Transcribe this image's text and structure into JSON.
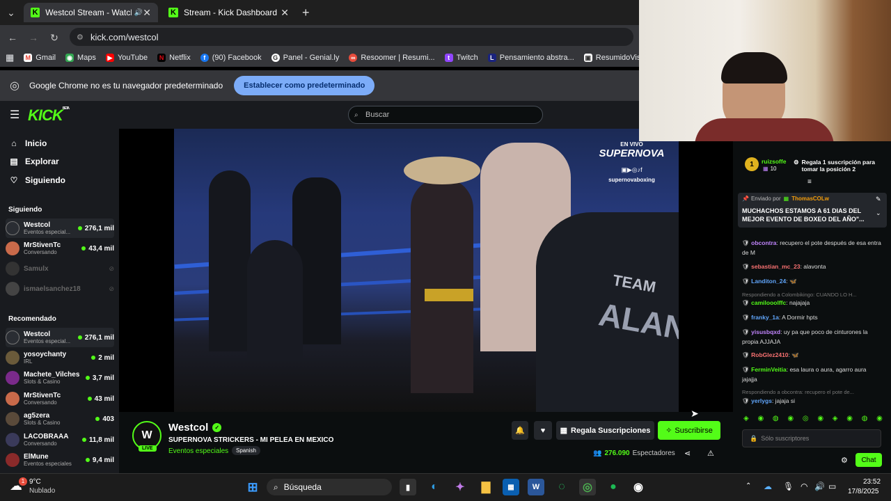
{
  "browser": {
    "tabs": [
      {
        "label": "Westcol Stream - Watch Live",
        "active": true
      },
      {
        "label": "Stream - Kick Dashboard",
        "active": false
      }
    ],
    "url": "kick.com/westcol",
    "bookmarks": [
      "Gmail",
      "Maps",
      "YouTube",
      "Netflix",
      "(90) Facebook",
      "Panel - Genial.ly",
      "Resoomer | Resumi...",
      "Twitch",
      "Pensamiento abstra...",
      "ResumidoVisualBasi..."
    ],
    "infobar": {
      "text": "Google Chrome no es tu navegador predeterminado",
      "button": "Establecer como predeterminado"
    }
  },
  "kick": {
    "logo": "KICK",
    "beta": "BETA",
    "search_placeholder": "Buscar",
    "nav": [
      "Inicio",
      "Explorar",
      "Siguiendo"
    ],
    "following_title": "Siguiendo",
    "following": [
      {
        "name": "Westcol",
        "sub": "Eventos especial...",
        "viewers": "276,1 mil",
        "color": "#2a2d33"
      },
      {
        "name": "MrStivenTc",
        "sub": "Conversando",
        "viewers": "43,4 mil",
        "color": "#c96a4a"
      },
      {
        "name": "Samulx",
        "sub": "",
        "viewers": "",
        "color": "#333"
      },
      {
        "name": "ismaelsanchez18",
        "sub": "",
        "viewers": "",
        "color": "#444"
      }
    ],
    "recommended_title": "Recomendado",
    "recommended": [
      {
        "name": "Westcol",
        "sub": "Eventos especial...",
        "viewers": "276,1 mil",
        "color": "#2a2d33"
      },
      {
        "name": "yosoychanty",
        "sub": "IRL",
        "viewers": "2 mil",
        "color": "#6a5a3a"
      },
      {
        "name": "Machete_Vilches",
        "sub": "Slots & Casino",
        "viewers": "3,7 mil",
        "color": "#7a2a8a"
      },
      {
        "name": "MrStivenTc",
        "sub": "Conversando",
        "viewers": "43 mil",
        "color": "#c96a4a"
      },
      {
        "name": "ag5zera",
        "sub": "Slots & Casino",
        "viewers": "403",
        "color": "#5a4a3a"
      },
      {
        "name": "LACOBRAAA",
        "sub": "Conversando",
        "viewers": "11,8 mil",
        "color": "#3a3a5a"
      },
      {
        "name": "ElMune",
        "sub": "Eventos especiales",
        "viewers": "9,4 mil",
        "color": "#8a2a2a"
      }
    ],
    "stream": {
      "channel": "Westcol",
      "title": "SUPERNOVA STRICKERS - MI PELEA EN MEXICO",
      "category": "Eventos especiales",
      "language": "Spanish",
      "viewers": "276.090",
      "viewers_label": "Espectadores",
      "gift_button": "Regala Suscripciones",
      "subscribe_button": "Suscribirse",
      "live": "LIVE"
    },
    "video_overlay": {
      "line1": "EN VIVO",
      "line2": "SUPERNOVA",
      "handle": "supernovaboxing",
      "team": "TEAM",
      "team2": "ALAN"
    },
    "chat": {
      "top_gifter": {
        "rank": "1",
        "name": "ruizsoffe",
        "count": "10",
        "cta": "Regala 1 suscripción para tomar la posición 2"
      },
      "pinned": {
        "by": "Enviado por",
        "user": "ThomasCOLw",
        "text": "MUCHACHOS ESTAMOS A 61 DIAS DEL MEJOR EVENTO DE BOXEO DEL AÑO\"..."
      },
      "messages": [
        {
          "user": "obcontra",
          "color": "#c084fc",
          "text": ": recupero el pote después de esa entra de M"
        },
        {
          "user": "sebastian_mc_23",
          "color": "#f87171",
          "text": ": alavonta"
        },
        {
          "user": "Landiton_24",
          "color": "#60a5fa",
          "text": ": 🦋"
        },
        {
          "reply": "Respondiendo a Colombikingo: CUANDO LO H...",
          "user": "camilooolffc",
          "color": "#53fc18",
          "text": ": najajaja"
        },
        {
          "user": "franky_1a",
          "color": "#60a5fa",
          "text": ": A Dormir hpts"
        },
        {
          "user": "yisusbqxd",
          "color": "#c084fc",
          "text": ": uy pa que poco de cinturones la propia AJJAJA"
        },
        {
          "user": "RobGlez2410",
          "color": "#f87171",
          "text": ": 🦋"
        },
        {
          "user": "FerminVeitia",
          "color": "#53fc18",
          "text": ": esa laura o aura, agarro aura jajajja"
        },
        {
          "reply": "Respondiendo a obcontra: recupero el pote de...",
          "user": "yerlygs",
          "color": "#60a5fa",
          "text": ": jajaja si"
        }
      ],
      "input_placeholder": "Sólo suscriptores",
      "send": "Chat"
    }
  },
  "taskbar": {
    "weather_temp": "9°C",
    "weather_desc": "Nublado",
    "badge": "1",
    "search": "Búsqueda",
    "time": "23:52",
    "date": "17/8/2025"
  }
}
